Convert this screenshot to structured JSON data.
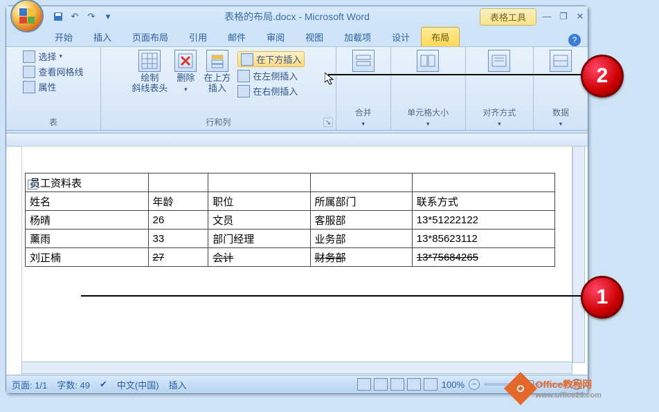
{
  "title": "表格的布局.docx - Microsoft Word",
  "contextual_tab": "表格工具",
  "tabs": [
    "开始",
    "插入",
    "页面布局",
    "引用",
    "邮件",
    "审阅",
    "视图",
    "加载项",
    "设计",
    "布局"
  ],
  "active_tab": 9,
  "ribbon": {
    "group1": {
      "title": "表",
      "select": "选择",
      "gridlines": "查看网格线",
      "properties": "属性"
    },
    "group2": {
      "title": "行和列",
      "draw_diag": "绘制\n斜线表头",
      "delete": "删除",
      "insert_above": "在上方\n插入",
      "insert_below": "在下方插入",
      "insert_left": "在左侧插入",
      "insert_right": "在右侧插入"
    },
    "group3": {
      "title": "合并"
    },
    "group4": {
      "title": "单元格大小"
    },
    "group5": {
      "title": "对齐方式"
    },
    "group6": {
      "title": "数据"
    }
  },
  "table": {
    "title_row": "员工资料表",
    "headers": [
      "姓名",
      "年龄",
      "职位",
      "所属部门",
      "联系方式"
    ],
    "rows": [
      [
        "杨晴",
        "26",
        "文员",
        "客服部",
        "13*51222122"
      ],
      [
        "薰雨",
        "33",
        "部门经理",
        "业务部",
        "13*85623112"
      ],
      [
        "刘正楠",
        "27",
        "会计",
        "财务部",
        "13*75684265"
      ]
    ]
  },
  "status": {
    "page": "页面: 1/1",
    "words": "字数: 49",
    "lang": "中文(中国)",
    "mode": "插入",
    "zoom": "100%"
  },
  "callouts": {
    "c1": "1",
    "c2": "2"
  },
  "watermark": {
    "brand": "Office教程网",
    "url": "www.office26.com"
  }
}
